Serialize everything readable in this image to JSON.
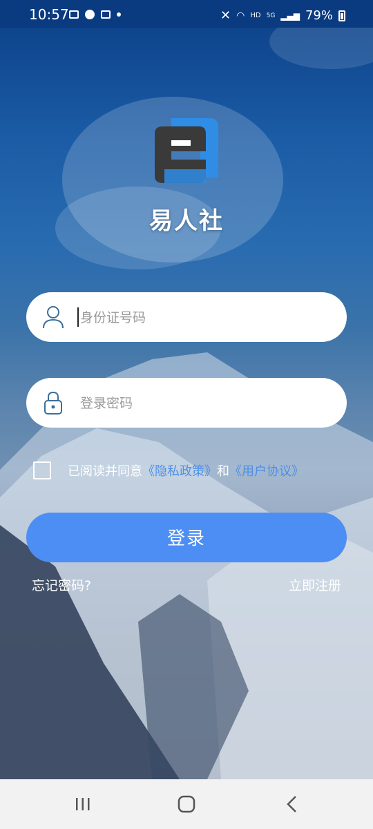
{
  "status_bar": {
    "time": "10:57",
    "network": "HD",
    "signal": "5G",
    "battery": "79%"
  },
  "app": {
    "name": "易人社"
  },
  "form": {
    "id_placeholder": "身份证号码",
    "password_placeholder": "登录密码",
    "agree_prefix": "已阅读并同意",
    "privacy_link": "《隐私政策》",
    "and_text": "和",
    "terms_link": "《用户协议》",
    "login_label": "登录",
    "forgot_label": "忘记密码?",
    "register_label": "立即注册"
  },
  "colors": {
    "primary": "#4c8ef3",
    "link": "#4e8fe8",
    "status_bar": "#0a3a80"
  },
  "nav": {
    "icons": [
      "recent-apps-icon",
      "home-icon",
      "back-icon"
    ]
  }
}
